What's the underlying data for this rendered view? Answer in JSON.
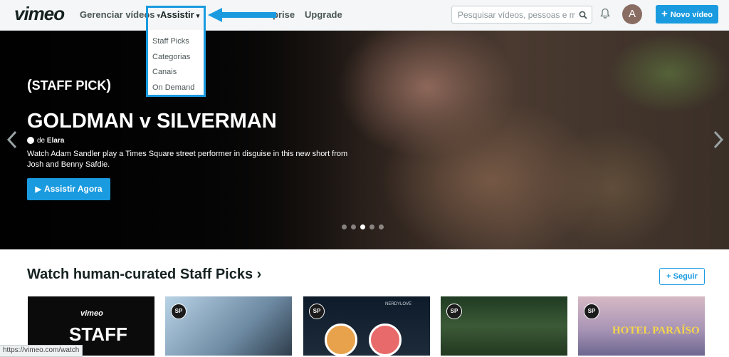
{
  "header": {
    "logo": "vimeo",
    "nav": {
      "manage_videos": "Gerenciar vídeos",
      "watch": "Assistir",
      "enterprise_partial": "prise",
      "upgrade": "Upgrade"
    },
    "search_placeholder": "Pesquisar vídeos, pessoas e mais",
    "avatar_letter": "A",
    "new_video": "Novo vídeo"
  },
  "dropdown": {
    "items": [
      "Staff Picks",
      "Categorias",
      "Canais",
      "On Demand"
    ]
  },
  "hero": {
    "badge": "STAFF PICK",
    "title": "GOLDMAN v SILVERMAN",
    "by_prefix": "de",
    "author": "Elara",
    "description": "Watch Adam Sandler play a Times Square street performer in disguise in this new short from Josh and Benny Safdie.",
    "cta": "Assistir Agora",
    "dots": 5,
    "active_dot": 3
  },
  "section": {
    "title": "Watch human-curated Staff Picks ›",
    "follow": "+ Seguir"
  },
  "thumbs": {
    "t1_vimeo": "vimeo",
    "t1_staff": "STAFF",
    "t3_label": "NERDYLOVE",
    "t5_label": "HOTEL PARAÍSO",
    "sp": "SP"
  },
  "status_url": "https://vimeo.com/watch",
  "colors": {
    "accent": "#1a9be0",
    "text_dark": "#162221"
  }
}
